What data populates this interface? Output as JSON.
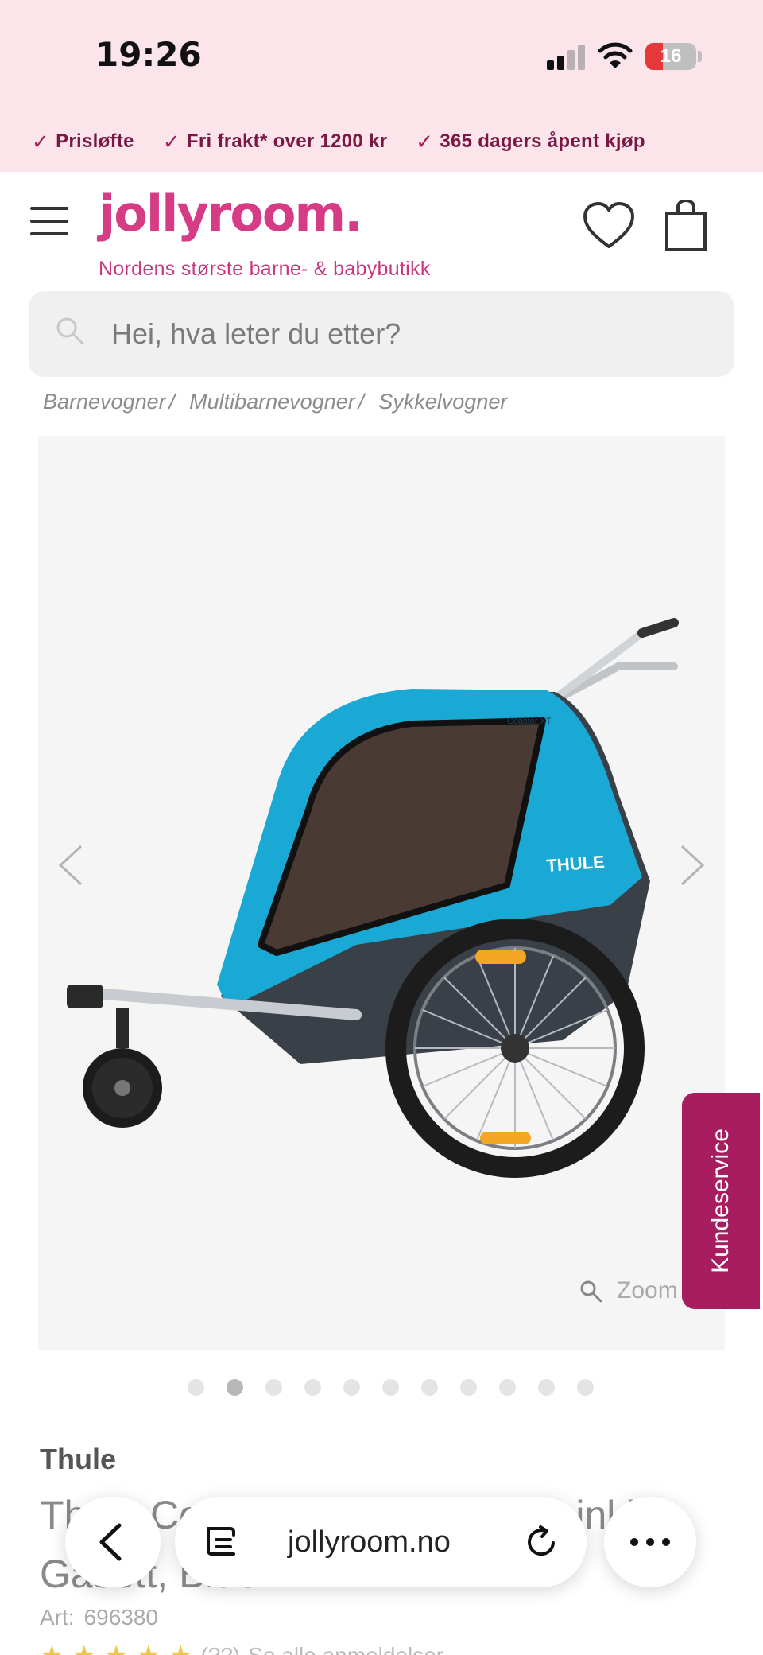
{
  "status_bar": {
    "time": "19:26",
    "battery": "16"
  },
  "usp": [
    {
      "icon": "check-icon",
      "label": "Prisløfte"
    },
    {
      "icon": "check-icon",
      "label": "Fri frakt* over 1200 kr"
    },
    {
      "icon": "check-icon",
      "label": "365 dagers åpent kjøp"
    }
  ],
  "header": {
    "logo": "jollyroom.",
    "tagline": "Nordens største barne- & babybutikk",
    "icons": [
      "menu-icon",
      "heart-icon",
      "shopping-bag-icon"
    ]
  },
  "search": {
    "placeholder": "Hei, hva leter du etter?"
  },
  "breadcrumbs": [
    "Barnevogner",
    "Multibarnevogner",
    "Sykkelvogner"
  ],
  "gallery": {
    "zoom_label": "Zoom",
    "image_count": 11,
    "active_index": 1
  },
  "kundeservice": "Kundeservice",
  "product": {
    "brand": "Thule",
    "title": "Thule Coaster XT Sykkelvogn inkl Gåsett, Blue",
    "art_label": "Art:",
    "art_number": "696380",
    "rating_count": "(??)",
    "reviews_link": "Se alle anmeldelser"
  },
  "browser": {
    "url": "jollyroom.no"
  },
  "colors": {
    "brand_pink": "#d63b86",
    "usp_text": "#7a1845",
    "kundeservice_bg": "#a81d5f",
    "trailer_blue": "#1aa9d4"
  }
}
